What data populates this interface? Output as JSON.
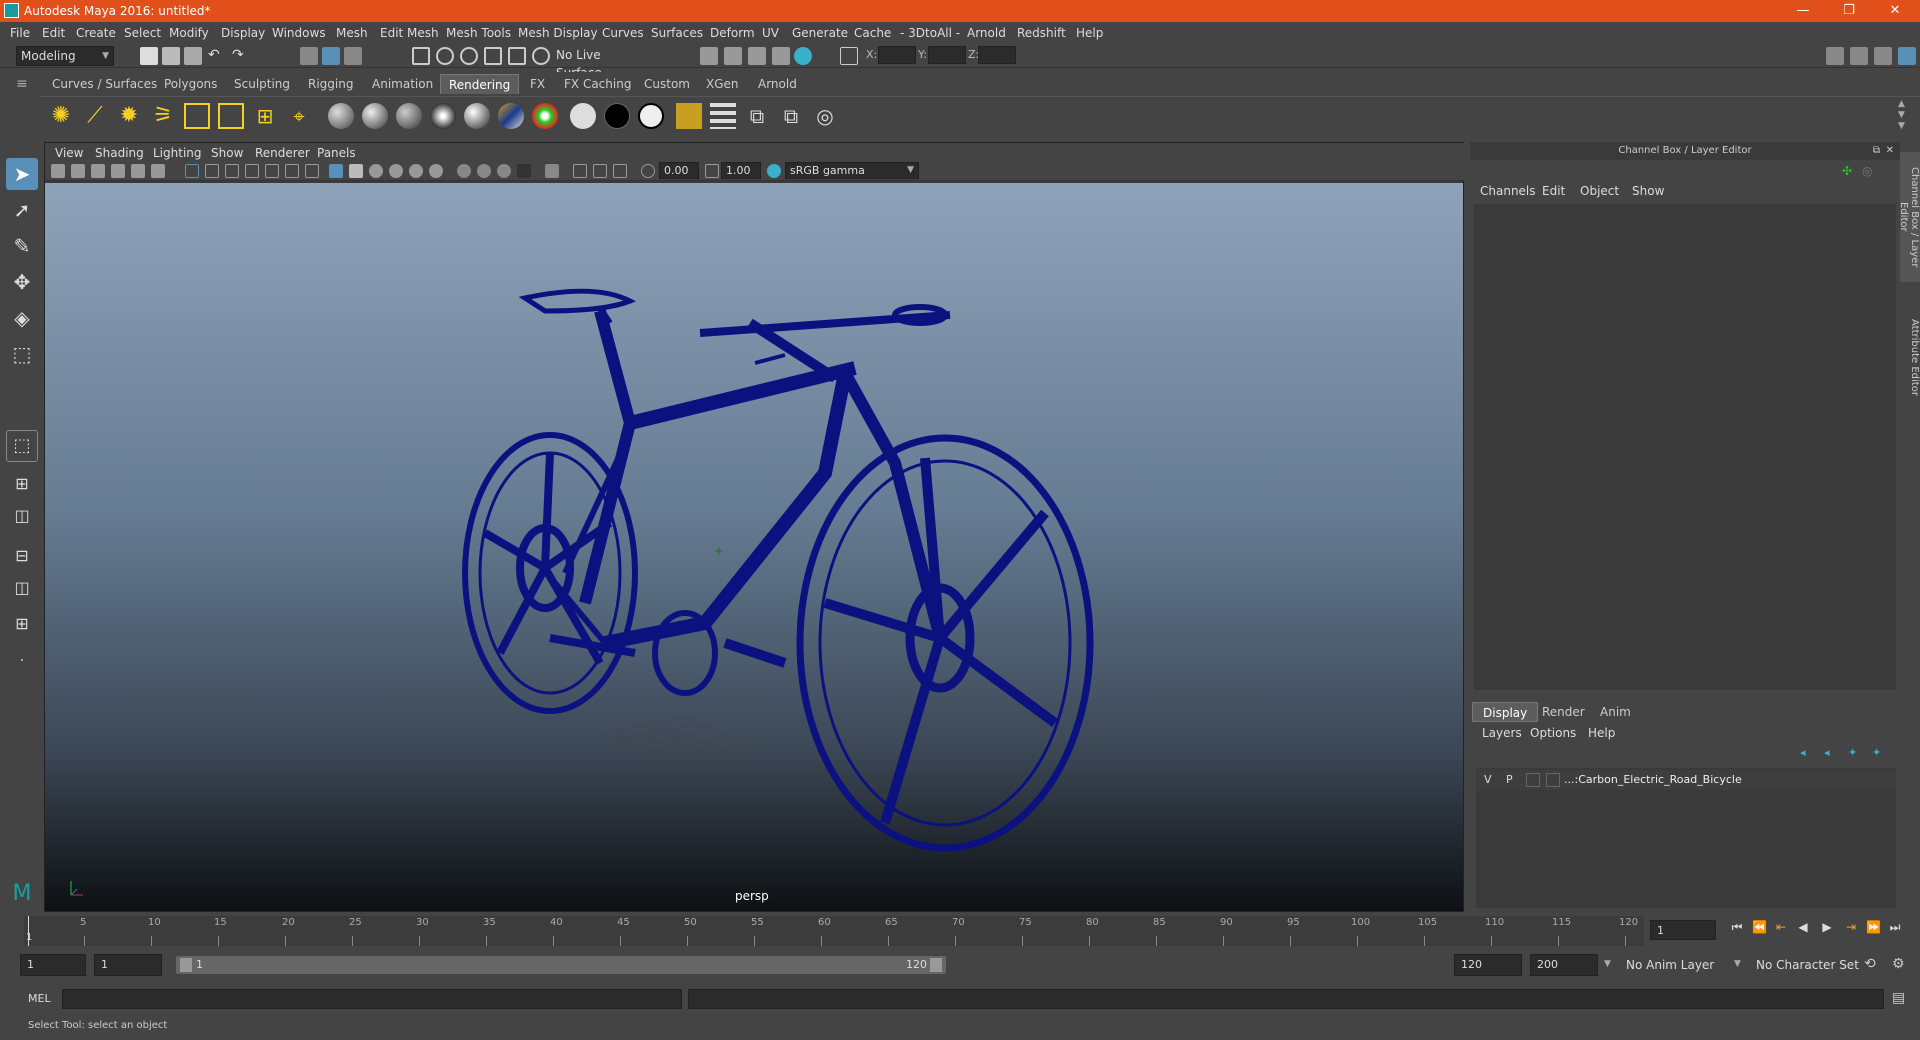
{
  "window": {
    "title": "Autodesk Maya 2016: untitled*",
    "minimize": "—",
    "restore": "❐",
    "close": "✕"
  },
  "menubar": [
    "File",
    "Edit",
    "Create",
    "Select",
    "Modify",
    "Display",
    "Windows",
    "Mesh",
    "Edit Mesh",
    "Mesh Tools",
    "Mesh Display",
    "Curves",
    "Surfaces",
    "Deform",
    "UV",
    "Generate",
    "Cache",
    "- 3DtoAll -",
    "Arnold",
    "Redshift",
    "Help"
  ],
  "statusline": {
    "mode": "Modeling",
    "live_surface": "No Live Surface",
    "x_label": "X:",
    "y_label": "Y:",
    "z_label": "Z:"
  },
  "shelf_tabs": [
    "Curves / Surfaces",
    "Polygons",
    "Sculpting",
    "Rigging",
    "Animation",
    "Rendering",
    "FX",
    "FX Caching",
    "Custom",
    "XGen",
    "Arnold"
  ],
  "active_shelf_tab": "Rendering",
  "viewport": {
    "menu": [
      "View",
      "Shading",
      "Lighting",
      "Show",
      "Renderer",
      "Panels"
    ],
    "exposure": "0.00",
    "gamma": "1.00",
    "color_space": "sRGB gamma",
    "camera_label": "persp"
  },
  "right_panel": {
    "header": "Channel Box / Layer Editor",
    "channel_menu": [
      "Channels",
      "Edit",
      "Object",
      "Show"
    ],
    "layer_tabs": [
      "Display",
      "Render",
      "Anim"
    ],
    "active_layer_tab": "Display",
    "layer_menu": [
      "Layers",
      "Options",
      "Help"
    ],
    "layer": {
      "v": "V",
      "p": "P",
      "name": "...:Carbon_Electric_Road_Bicycle"
    },
    "side_tabs": [
      "Channel Box / Layer Editor",
      "Attribute Editor"
    ]
  },
  "timeline": {
    "ticks": [
      "5",
      "10",
      "15",
      "20",
      "25",
      "30",
      "35",
      "40",
      "45",
      "50",
      "55",
      "60",
      "65",
      "70",
      "75",
      "80",
      "85",
      "90",
      "95",
      "100",
      "105",
      "110",
      "115",
      "120"
    ],
    "start_tick": "1",
    "current_frame": "1"
  },
  "range": {
    "start": "1",
    "playback_start": "1",
    "slider_start": "1",
    "slider_end": "120",
    "playback_end": "120",
    "end": "200",
    "anim_layer": "No Anim Layer",
    "character_set": "No Character Set"
  },
  "command_line": {
    "label": "MEL"
  },
  "help_line": "Select Tool: select an object",
  "colors": {
    "titlebar": "#e1501a",
    "wireframe": "#0b1280",
    "ui_bg": "#444444",
    "active_tab": "#5d5d5d"
  }
}
